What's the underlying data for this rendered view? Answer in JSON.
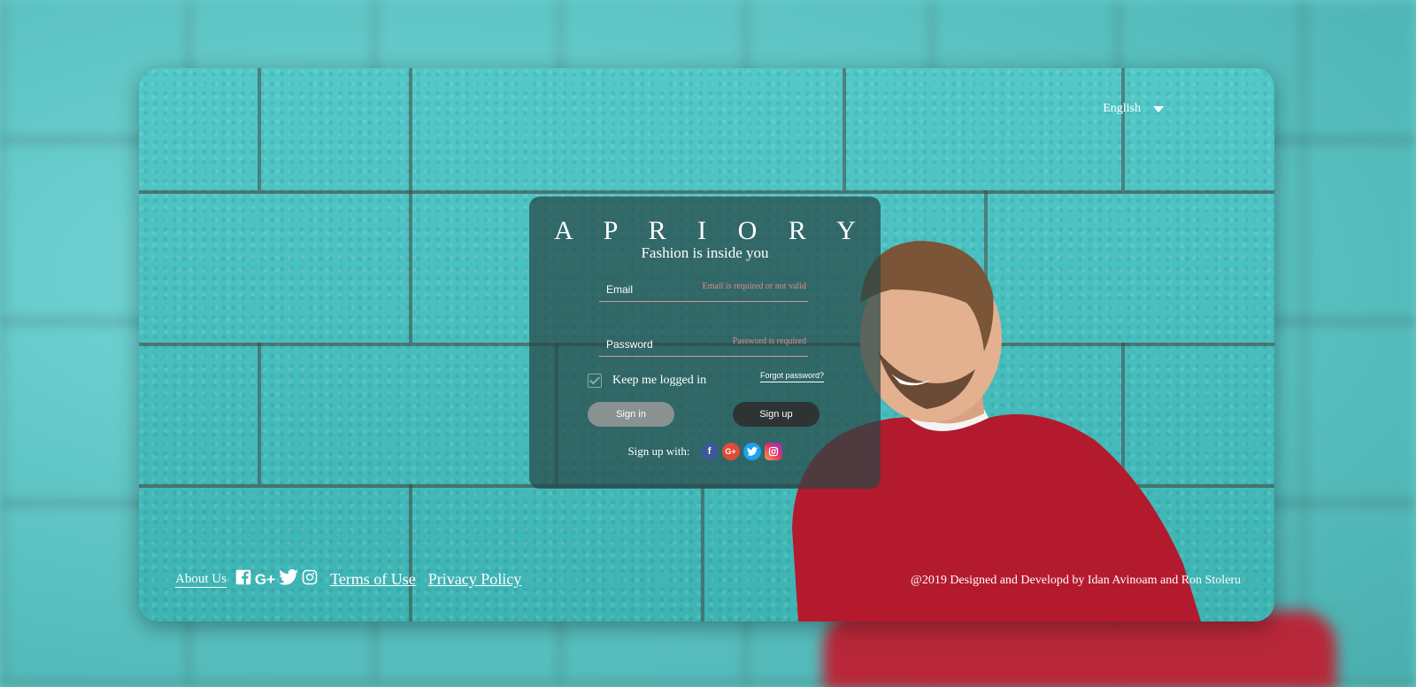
{
  "language": {
    "selected": "English"
  },
  "login": {
    "brand": "A P R I O R Y",
    "tagline": "Fashion is inside you",
    "email_label": "Email",
    "email_error": "Email is required or not valid",
    "password_label": "Password",
    "password_error": "Password is required",
    "remember_label": "Keep me logged in",
    "forgot_label": "Forgot password?",
    "signin_label": "Sign in",
    "signup_label": "Sign up",
    "social_label": "Sign up with:",
    "social_icons": [
      "facebook-icon",
      "google-plus-icon",
      "twitter-icon",
      "instagram-icon"
    ]
  },
  "footer": {
    "about": "About Us",
    "icons": [
      "facebook-icon",
      "google-plus-icon",
      "twitter-icon",
      "instagram-icon"
    ],
    "terms": "Terms of Use",
    "privacy": "Privacy Policy",
    "credit": "@2019 Designed and Developd by Idan Avinoam and Ron Stoleru"
  },
  "colors": {
    "wall": "#47bdbd",
    "panel": "#284646",
    "error": "#e08a8a",
    "signup_button": "#2e3333",
    "signin_button": "#8a9191",
    "sweater": "#b41a2d"
  }
}
